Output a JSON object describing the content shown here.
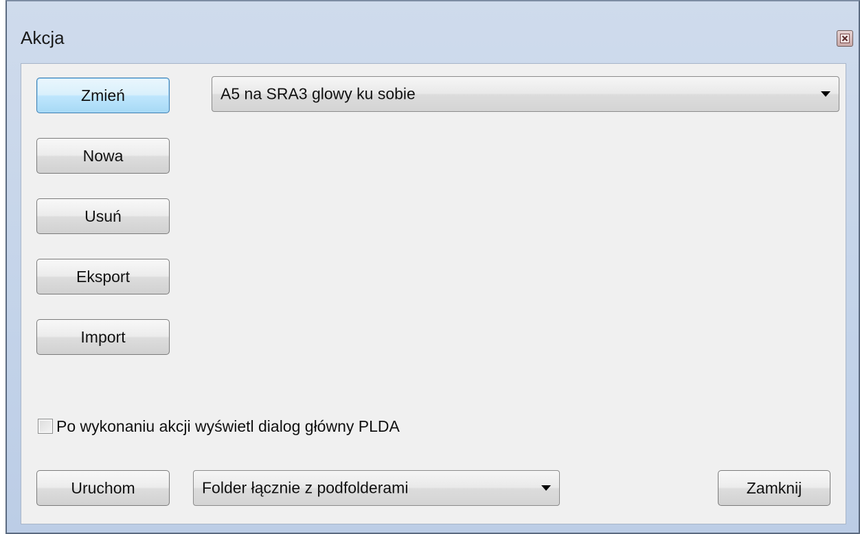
{
  "window": {
    "title": "Akcja"
  },
  "actions": {
    "change_label": "Zmień",
    "new_label": "Nowa",
    "delete_label": "Usuń",
    "export_label": "Eksport",
    "import_label": "Import"
  },
  "action_select": {
    "selected": "A5 na SRA3 glowy ku sobie"
  },
  "options": {
    "show_dialog_label": "Po wykonaniu akcji wyświetl dialog główny PLDA",
    "show_dialog_checked": false
  },
  "footer": {
    "run_label": "Uruchom",
    "scope_selected": "Folder łącznie z podfolderami",
    "close_label": "Zamknij"
  },
  "icons": {
    "close": "close-icon",
    "dropdown": "chevron-down-icon",
    "checkbox": "checkbox-icon"
  }
}
